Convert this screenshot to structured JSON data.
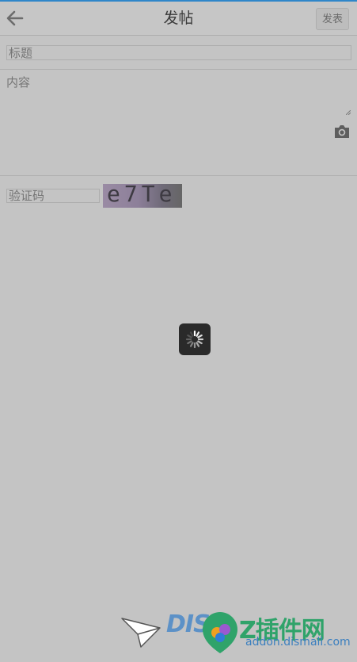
{
  "header": {
    "title": "发帖",
    "publish_label": "发表"
  },
  "form": {
    "subject_placeholder": "标题",
    "content_placeholder": "内容",
    "captcha_placeholder": "验证码",
    "captcha_code": "e7Te"
  },
  "watermark": {
    "brand_word": "DIS",
    "cn_text": "Z插件网",
    "site": "addon.dismall.com"
  },
  "colors": {
    "accent": "#2f86c9",
    "background": "#c4c4c4",
    "loader_bg": "#2a2a2a"
  },
  "icons": {
    "back": "arrow-left-icon",
    "camera": "camera-icon",
    "loading": "spinner-icon"
  }
}
